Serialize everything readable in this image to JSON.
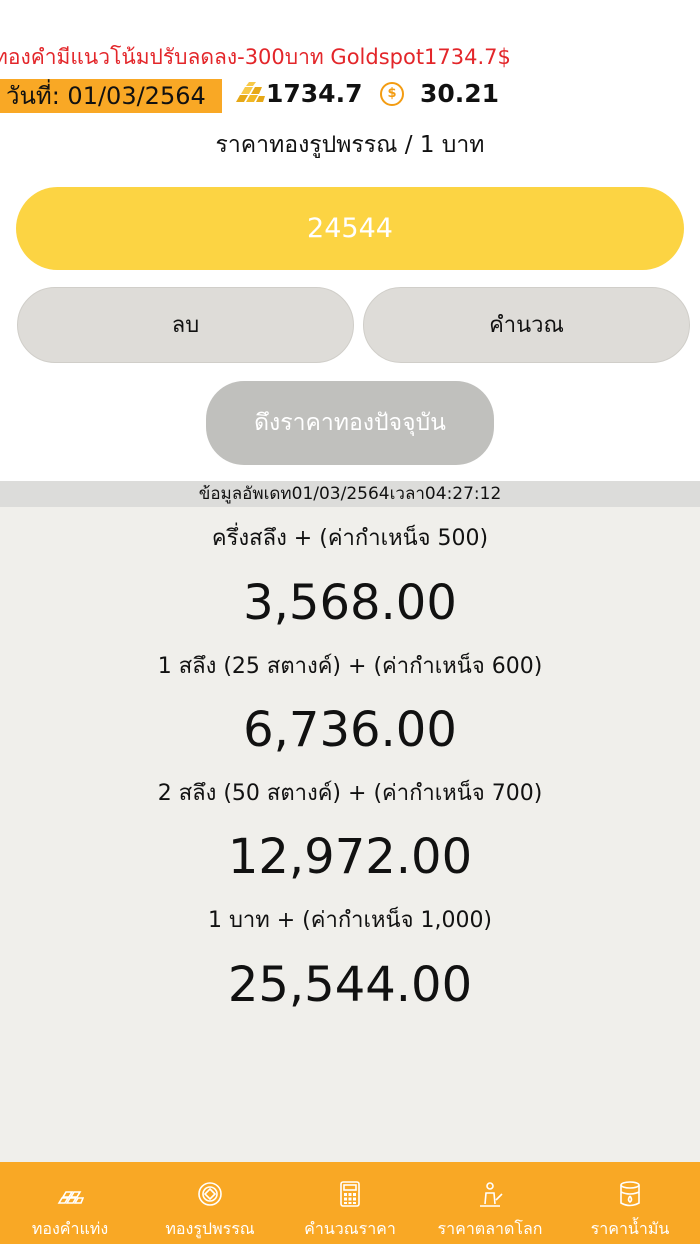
{
  "ticker": {
    "text": "ทองคำมีแนวโน้มปรับลดลง-300บาท Goldspot1734.7$"
  },
  "info": {
    "date_text": "วันที่: 01/03/2564",
    "gold_spot": "1734.7",
    "fx_rate": "30.21"
  },
  "form": {
    "section_label": "ราคาทองรูปพรรณ / 1 บาท",
    "price_value": "24544",
    "clear_label": "ลบ",
    "calc_label": "คำนวณ",
    "fetch_label": "ดึงราคาทองปัจจุบัน"
  },
  "results": {
    "update_text": "ข้อมูลอัพเดท01/03/2564เวลา04:27:12",
    "items": [
      {
        "label": "ครึ่งสลึง +  (ค่ากำเหน็จ 500)",
        "value": "3,568.00"
      },
      {
        "label": "1 สลึง (25 สตางค์) +  (ค่ากำเหน็จ 600)",
        "value": "6,736.00"
      },
      {
        "label": "2 สลึง (50 สตางค์) +  (ค่ากำเหน็จ 700)",
        "value": "12,972.00"
      },
      {
        "label": "1 บาท  +  (ค่ากำเหน็จ 1,000)",
        "value": "25,544.00"
      }
    ]
  },
  "tabs": [
    {
      "label": "ทองคำแท่ง",
      "icon": "gold-bars-icon"
    },
    {
      "label": "ทองรูปพรรณ",
      "icon": "gold-ornament-icon"
    },
    {
      "label": "คำนวณราคา",
      "icon": "calculator-icon"
    },
    {
      "label": "ราคาตลาดโลก",
      "icon": "world-market-icon"
    },
    {
      "label": "ราคาน้ำมัน",
      "icon": "oil-barrel-icon"
    }
  ],
  "colors": {
    "accent": "#f9a825",
    "input": "#fcd443",
    "ticker": "#e3262a"
  }
}
